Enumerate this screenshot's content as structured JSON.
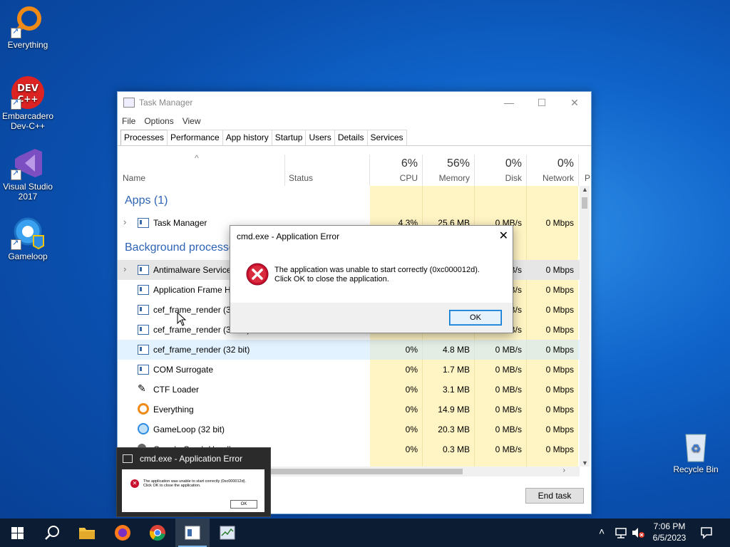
{
  "desktop": {
    "icons": [
      {
        "label": "Everything"
      },
      {
        "label": "Embarcadero Dev-C++"
      },
      {
        "label": "Visual Studio 2017"
      },
      {
        "label": "Gameloop"
      },
      {
        "label": "Recycle Bin"
      }
    ]
  },
  "task_manager": {
    "title": "Task Manager",
    "menu": [
      "File",
      "Options",
      "View"
    ],
    "tabs": [
      "Processes",
      "Performance",
      "App history",
      "Startup",
      "Users",
      "Details",
      "Services"
    ],
    "columns": {
      "name": "Name",
      "status": "Status",
      "cpu": {
        "pct": "6%",
        "label": "CPU"
      },
      "memory": {
        "pct": "56%",
        "label": "Memory"
      },
      "disk": {
        "pct": "0%",
        "label": "Disk"
      },
      "network": {
        "pct": "0%",
        "label": "Network"
      },
      "extra": "P"
    },
    "groups": {
      "apps": "Apps (1)",
      "background": "Background processes"
    },
    "rows": [
      {
        "name": "Task Manager",
        "cpu": "4.3%",
        "mem": "25.6 MB",
        "disk": "0 MB/s",
        "net": "0 Mbps"
      },
      {
        "name": "Antimalware Service",
        "cpu": "",
        "mem": "",
        "disk": "B/s",
        "net": "0 Mbps"
      },
      {
        "name": "Application Frame H",
        "cpu": "",
        "mem": "",
        "disk": "B/s",
        "net": "0 Mbps"
      },
      {
        "name": "cef_frame_render (32",
        "cpu": "",
        "mem": "",
        "disk": "B/s",
        "net": "0 Mbps"
      },
      {
        "name": "cef_frame_render (32 bit)",
        "cpu": "",
        "mem": "",
        "disk": "B/s",
        "net": "0 Mbps"
      },
      {
        "name": "cef_frame_render (32 bit)",
        "cpu": "0%",
        "mem": "4.8 MB",
        "disk": "0 MB/s",
        "net": "0 Mbps"
      },
      {
        "name": "COM Surrogate",
        "cpu": "0%",
        "mem": "1.7 MB",
        "disk": "0 MB/s",
        "net": "0 Mbps"
      },
      {
        "name": "CTF Loader",
        "cpu": "0%",
        "mem": "3.1 MB",
        "disk": "0 MB/s",
        "net": "0 Mbps"
      },
      {
        "name": "Everything",
        "cpu": "0%",
        "mem": "14.9 MB",
        "disk": "0 MB/s",
        "net": "0 Mbps"
      },
      {
        "name": "GameLoop (32 bit)",
        "cpu": "0%",
        "mem": "20.3 MB",
        "disk": "0 MB/s",
        "net": "0 Mbps"
      },
      {
        "name": "Google Crash Handler",
        "cpu": "0%",
        "mem": "0.3 MB",
        "disk": "0 MB/s",
        "net": "0 Mbps"
      }
    ],
    "end_task": "End task"
  },
  "dialog": {
    "title": "cmd.exe - Application Error",
    "line1": "The application was unable to start correctly (0xc000012d).",
    "line2": "Click OK to close the application.",
    "ok": "OK"
  },
  "thumbnail": {
    "title": "cmd.exe - Application Error",
    "line1": "The application was unable to start correctly (0xc000012d).",
    "line2": "Click OK to close the application.",
    "ok": "OK"
  },
  "taskbar": {
    "time": "7:06 PM",
    "date": "6/5/2023"
  },
  "colors": {
    "taskbar": "#0c1d33",
    "accent": "#0078d7",
    "highlight": "#fff4c4",
    "group": "#2e63b5"
  }
}
